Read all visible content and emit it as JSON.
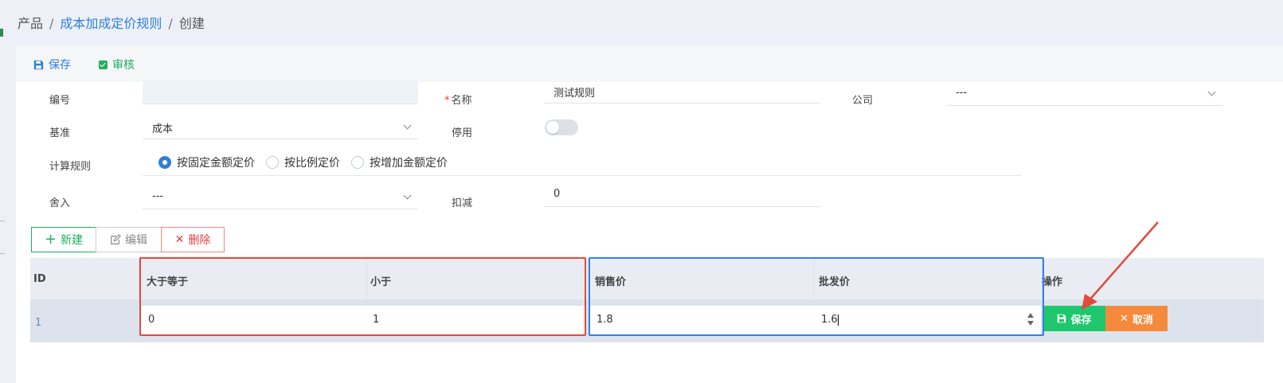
{
  "breadcrumb": {
    "root": "产品",
    "middle": "成本加成定价规则",
    "current": "创建",
    "sep": "/"
  },
  "toolbar": {
    "save_label": "保存",
    "audit_label": "审核"
  },
  "form": {
    "number": {
      "label": "编号",
      "value": ""
    },
    "name": {
      "label": "名称",
      "required_mark": "*",
      "value": "测试规则"
    },
    "company": {
      "label": "公司",
      "value": "---"
    },
    "basis": {
      "label": "基准",
      "value": "成本"
    },
    "disabled": {
      "label": "停用",
      "on": false
    },
    "calc_rule": {
      "label": "计算规则",
      "options": [
        "按固定金额定价",
        "按比例定价",
        "按增加金额定价"
      ],
      "selected": 0
    },
    "rounding": {
      "label": "舍入",
      "value": "---"
    },
    "deduction": {
      "label": "扣减",
      "value": "0"
    }
  },
  "actions": {
    "new_label": "新建",
    "edit_label": "编辑",
    "delete_label": "删除"
  },
  "table": {
    "headers": {
      "id": "ID",
      "gte": "大于等于",
      "lt": "小于",
      "sale_price": "销售价",
      "wholesale_price": "批发价",
      "ops": "操作"
    },
    "rows": [
      {
        "id": "1",
        "gte": "0",
        "lt": "1",
        "sale_price": "1.8",
        "wholesale_price": "1.6"
      }
    ],
    "row_save_label": "保存",
    "row_cancel_label": "取消"
  },
  "colors": {
    "accent": "#2f7fd8",
    "success": "#1ec76d",
    "warning": "#f58a3d",
    "danger": "#e04040",
    "annotation_red": "#e24a3b",
    "annotation_blue": "#2f80ed"
  }
}
